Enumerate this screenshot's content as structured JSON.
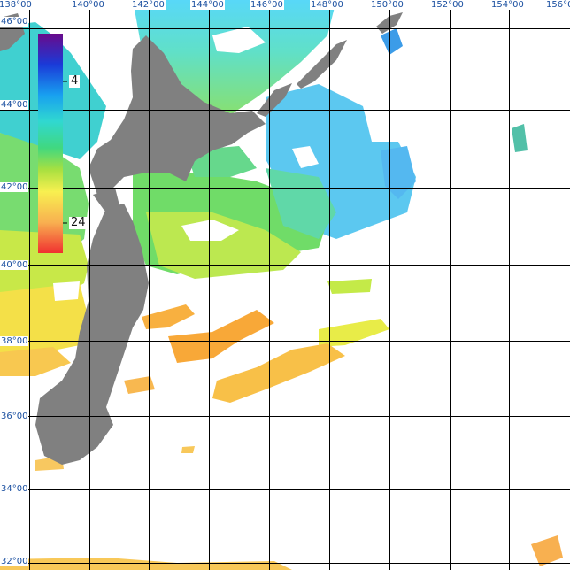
{
  "map": {
    "lon_labels": [
      "138°00",
      "140°00",
      "142°00",
      "144°00",
      "146°00",
      "148°00",
      "150°00",
      "152°00",
      "154°00",
      "156°0"
    ],
    "lat_labels": [
      "46°00",
      "44°00",
      "42°00",
      "40°00",
      "38°00",
      "36°00",
      "34°00",
      "32°00"
    ],
    "legend": {
      "tick_labels": [
        "4",
        "24"
      ],
      "colors": [
        "#6a0a8a",
        "#1a3ad8",
        "#18a0f0",
        "#30d8d0",
        "#40d880",
        "#a8e040",
        "#f8f050",
        "#f8b050",
        "#f03030"
      ]
    },
    "colors": {
      "land": "#808080",
      "no_data": "#ffffff",
      "grid": "#000000"
    }
  }
}
